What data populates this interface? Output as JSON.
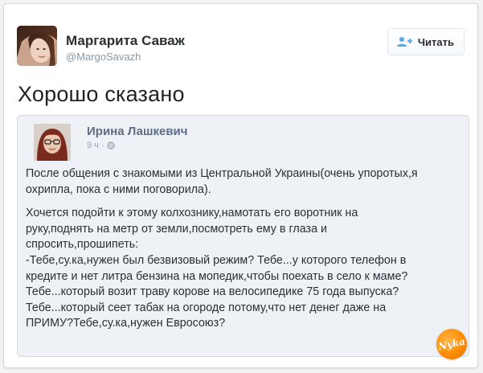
{
  "tweet": {
    "author_name": "Маргарита Саваж",
    "author_handle": "@MargoSavazh",
    "follow_label": "Читать",
    "text": "Хорошо сказано"
  },
  "embedded_post": {
    "author_name": "Ирина Лашкевич",
    "meta": "9 ч ·",
    "paragraph1": "После общения с знакомыми из Центральной Украины(очень упоротых,я охрипла, пока с ними поговорила).",
    "paragraph2": "Хочется подойти к этому колхознику,намотать его воротник на\nруку,поднять на метр от земли,посмотреть ему в глаза и\nспросить,прошипеть:\n-Тебе,су.ка,нужен был безвизовый режим? Тебе...у которого телефон в\nкредите и нет литра бензина на мопедик,чтобы поехать в село к маме?\nТебе...который возит траву корове на велосипедике 75 года выпуска?\nТебе...который сеет табак на огороде потому,что нет денег даже на\nПРИМУ?Тебе,су.ка,нужен Евросоюз?"
  },
  "watermark_text": "Nyka",
  "colors": {
    "accent": "#55acee",
    "watermark": "#ff8c00",
    "embed_bg": "#eef1f6"
  },
  "icons": {
    "follow": "add-user-icon",
    "privacy": "globe-icon"
  }
}
